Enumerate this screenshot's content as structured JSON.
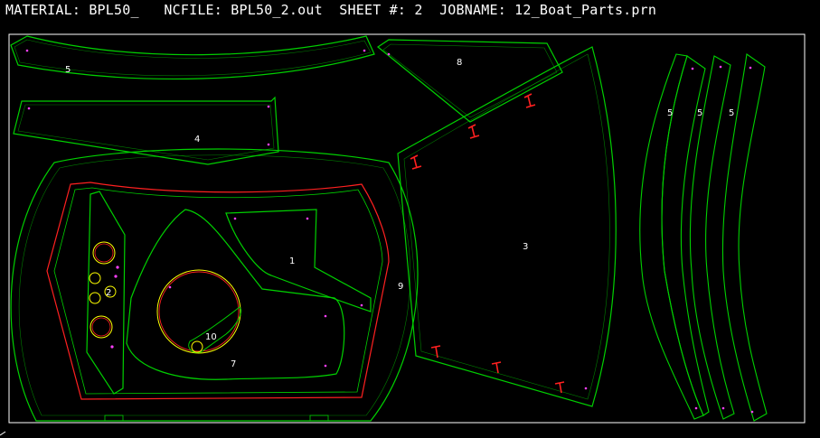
{
  "header": {
    "material_label": "MATERIAL:",
    "material_value": "BPL50_",
    "ncfile_label": "NCFILE:",
    "ncfile_value": "BPL50_2.out",
    "sheet_label": "SHEET #:",
    "sheet_value": "2",
    "jobname_label": "JOBNAME:",
    "jobname_value": "12_Boat_Parts.prn"
  },
  "parts": {
    "p5a": "5",
    "p4": "4",
    "p8": "8",
    "p3": "3",
    "p1": "1",
    "p9": "9",
    "p10": "10",
    "p7": "7",
    "p2": "2",
    "p5b": "5",
    "p5c": "5",
    "p5d": "5"
  },
  "colors": {
    "background": "#000000",
    "sheet_border": "#ffffff",
    "toolpath": "#00d000",
    "part_outline": "#ff2020",
    "marker": "#ff40ff",
    "text": "#ffffff",
    "accent_yellow": "#ffff00"
  }
}
